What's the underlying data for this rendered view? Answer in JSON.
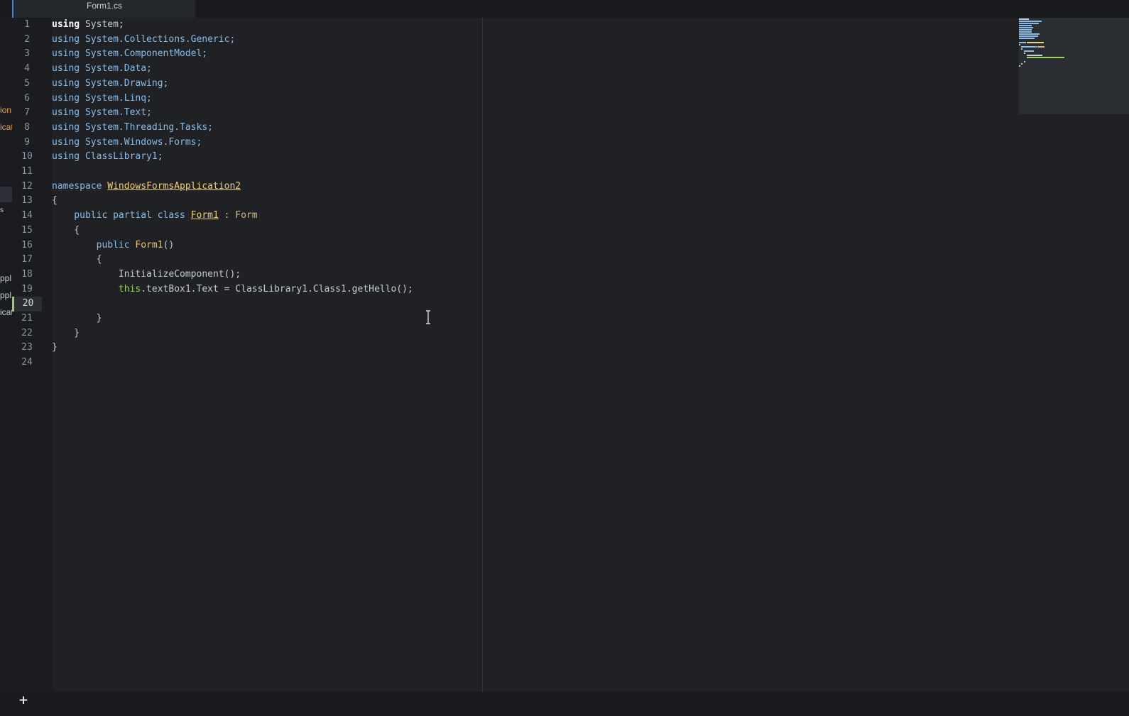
{
  "tabs": [
    {
      "label": "Form1.cs",
      "active": true
    }
  ],
  "side_panel": {
    "fragments": [
      "ion",
      "icat",
      "s",
      "ppl",
      "ppl",
      "icat"
    ],
    "colors": {
      "orange": "#e8a04a",
      "plain": "#c6cbd1"
    }
  },
  "editor": {
    "active_line": 20,
    "line_numbers": [
      "1",
      "2",
      "3",
      "4",
      "5",
      "6",
      "7",
      "8",
      "9",
      "10",
      "11",
      "12",
      "13",
      "14",
      "15",
      "16",
      "17",
      "18",
      "19",
      "20",
      "21",
      "22",
      "23",
      "24"
    ],
    "code": {
      "l1_kw": "using",
      "l1_rest": " System;",
      "l2_kw": "using",
      "l2_rest": " System.Collections.Generic;",
      "l3_kw": "using",
      "l3_rest": " System.ComponentModel;",
      "l4_kw": "using",
      "l4_rest": " System.Data;",
      "l5_kw": "using",
      "l5_rest": " System.Drawing;",
      "l6_kw": "using",
      "l6_rest": " System.Linq;",
      "l7_kw": "using",
      "l7_rest": " System.Text;",
      "l8_kw": "using",
      "l8_rest": " System.Threading.Tasks;",
      "l9_kw": "using",
      "l9_rest": " System.Windows.Forms;",
      "l10_kw": "using",
      "l10_rest": " ClassLibrary1;",
      "l12_kw": "namespace ",
      "l12_name": "WindowsFormsApplication2",
      "l13": "{",
      "l14_mod": "    public partial class ",
      "l14_name": "Form1",
      "l14_sep": " : ",
      "l14_base": "Form",
      "l15": "    {",
      "l16_mod": "        public ",
      "l16_name": "Form1",
      "l16_rest": "()",
      "l17": "        {",
      "l18_indent": "            ",
      "l18_call": "InitializeComponent",
      "l18_rest": "();",
      "l19_indent": "            ",
      "l19_this": "this",
      "l19_rest": ".textBox1.Text = ClassLibrary1.Class1.",
      "l19_call": "getHello",
      "l19_end": "();",
      "l21": "        }",
      "l22": "    }",
      "l23": "}"
    }
  },
  "statusbar": {
    "add_label": "+"
  },
  "icons": [
    "plus-icon",
    "text-cursor-icon"
  ],
  "colors": {
    "background": "#1f2125",
    "gutter": "#1a1c1f",
    "active_line_marker": "#9ecf63",
    "tab_accent": "#4b7fd1",
    "namespace_blue": "#89bde8",
    "type_yellow": "#f0d27a"
  }
}
